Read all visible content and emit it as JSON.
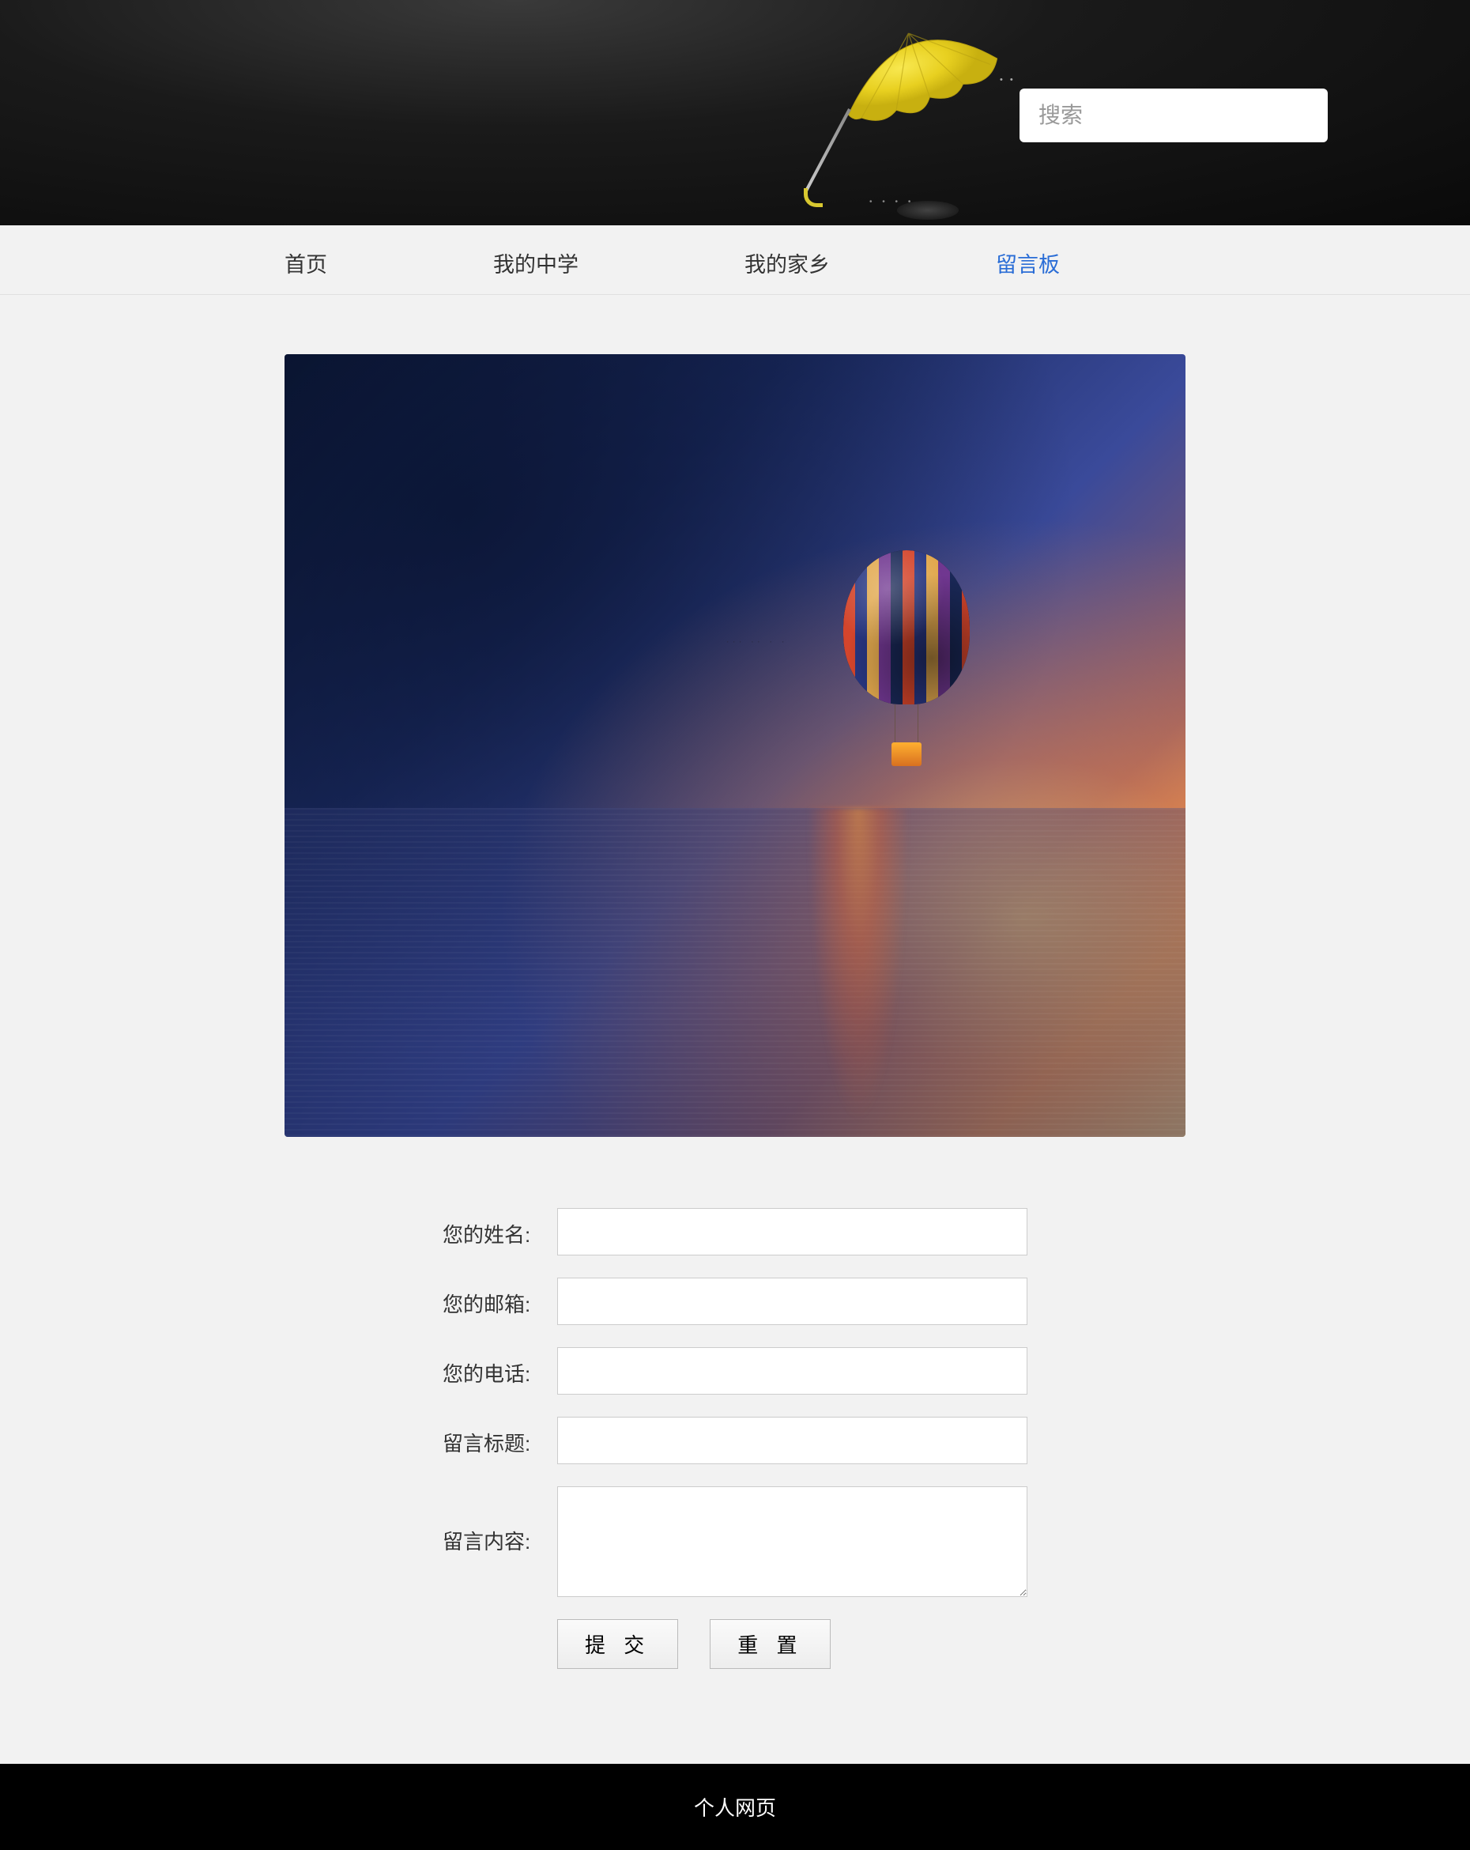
{
  "header": {
    "search_placeholder": "搜索",
    "icon_name": "yellow-umbrella"
  },
  "nav": {
    "items": [
      {
        "label": "首页",
        "active": false
      },
      {
        "label": "我的中学",
        "active": false
      },
      {
        "label": "我的家乡",
        "active": false
      },
      {
        "label": "留言板",
        "active": true
      }
    ]
  },
  "hero": {
    "description": "hot-air-balloon-over-sea-sunset"
  },
  "form": {
    "fields": [
      {
        "label": "您的姓名:",
        "type": "text",
        "name": "name-field",
        "value": ""
      },
      {
        "label": "您的邮箱:",
        "type": "text",
        "name": "email-field",
        "value": ""
      },
      {
        "label": "您的电话:",
        "type": "text",
        "name": "phone-field",
        "value": ""
      },
      {
        "label": "留言标题:",
        "type": "text",
        "name": "title-field",
        "value": ""
      },
      {
        "label": "留言内容:",
        "type": "textarea",
        "name": "content-field",
        "value": ""
      }
    ],
    "submit_label": "提 交",
    "reset_label": "重 置"
  },
  "footer": {
    "text": "个人网页"
  }
}
